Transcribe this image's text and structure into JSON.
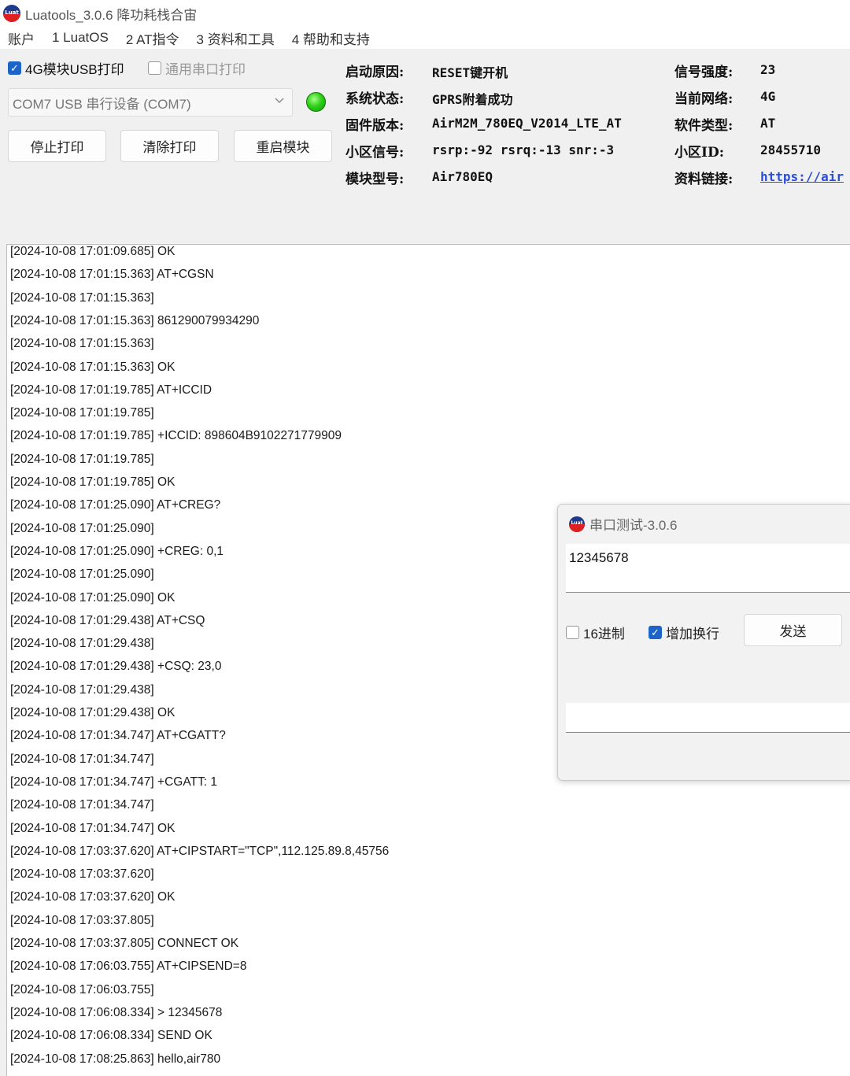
{
  "app": {
    "logo_text": "Luat",
    "title": "Luatools_3.0.6 降功耗栈合宙"
  },
  "menu": [
    "账户",
    "1 LuatOS",
    "2 AT指令",
    "3 资料和工具",
    "4 帮助和支持"
  ],
  "options": {
    "usb_print": {
      "label": "4G模块USB打印",
      "checked": true
    },
    "serial_print": {
      "label": "通用串口打印",
      "checked": false
    }
  },
  "port_select": {
    "value": "COM7 USB 串行设备 (COM7)"
  },
  "status_led": {
    "color": "#2fd11a"
  },
  "buttons": {
    "stop": "停止打印",
    "clear": "清除打印",
    "restart": "重启模块"
  },
  "info_left": [
    {
      "label": "启动原因:",
      "value": "RESET键开机"
    },
    {
      "label": "系统状态:",
      "value": "GPRS附着成功"
    },
    {
      "label": "固件版本:",
      "value": "AirM2M_780EQ_V2014_LTE_AT"
    },
    {
      "label": "小区信号:",
      "value": "rsrp:-92 rsrq:-13 snr:-3"
    },
    {
      "label": "模块型号:",
      "value": "Air780EQ"
    }
  ],
  "info_right": [
    {
      "label": "信号强度:",
      "value": "23"
    },
    {
      "label": "当前网络:",
      "value": "4G"
    },
    {
      "label": "软件类型:",
      "value": "AT"
    },
    {
      "label": "小区ID:",
      "value": "28455710"
    },
    {
      "label": "资料链接:",
      "value": "https://air"
    }
  ],
  "log": [
    "[2024-10-08 17:01:09.685] OK",
    "[2024-10-08 17:01:15.363] AT+CGSN",
    "[2024-10-08 17:01:15.363]",
    "[2024-10-08 17:01:15.363] 861290079934290",
    "[2024-10-08 17:01:15.363]",
    "[2024-10-08 17:01:15.363] OK",
    "[2024-10-08 17:01:19.785] AT+ICCID",
    "[2024-10-08 17:01:19.785]",
    "[2024-10-08 17:01:19.785] +ICCID: 898604B9102271779909",
    "[2024-10-08 17:01:19.785]",
    "[2024-10-08 17:01:19.785] OK",
    "[2024-10-08 17:01:25.090] AT+CREG?",
    "[2024-10-08 17:01:25.090]",
    "[2024-10-08 17:01:25.090] +CREG: 0,1",
    "[2024-10-08 17:01:25.090]",
    "[2024-10-08 17:01:25.090] OK",
    "[2024-10-08 17:01:29.438] AT+CSQ",
    "[2024-10-08 17:01:29.438]",
    "[2024-10-08 17:01:29.438] +CSQ: 23,0",
    "[2024-10-08 17:01:29.438]",
    "[2024-10-08 17:01:29.438] OK",
    "[2024-10-08 17:01:34.747] AT+CGATT?",
    "[2024-10-08 17:01:34.747]",
    "[2024-10-08 17:01:34.747] +CGATT: 1",
    "[2024-10-08 17:01:34.747]",
    "[2024-10-08 17:01:34.747] OK",
    "[2024-10-08 17:03:37.620] AT+CIPSTART=\"TCP\",112.125.89.8,45756",
    "[2024-10-08 17:03:37.620]",
    "[2024-10-08 17:03:37.620] OK",
    "[2024-10-08 17:03:37.805]",
    "[2024-10-08 17:03:37.805] CONNECT OK",
    "[2024-10-08 17:06:03.755] AT+CIPSEND=8",
    "[2024-10-08 17:06:03.755]",
    "[2024-10-08 17:06:08.334] > 12345678",
    "[2024-10-08 17:06:08.334] SEND OK",
    "[2024-10-08 17:08:25.863] hello,air780"
  ],
  "serial_dialog": {
    "title": "串口测试-3.0.6",
    "input_value": "12345678",
    "hex": {
      "label": "16进制",
      "checked": false
    },
    "newline": {
      "label": "增加换行",
      "checked": true
    },
    "send": "发送",
    "receive_value": ""
  },
  "colors": {
    "accent": "#1d64c8",
    "link": "#2a4fd6"
  }
}
